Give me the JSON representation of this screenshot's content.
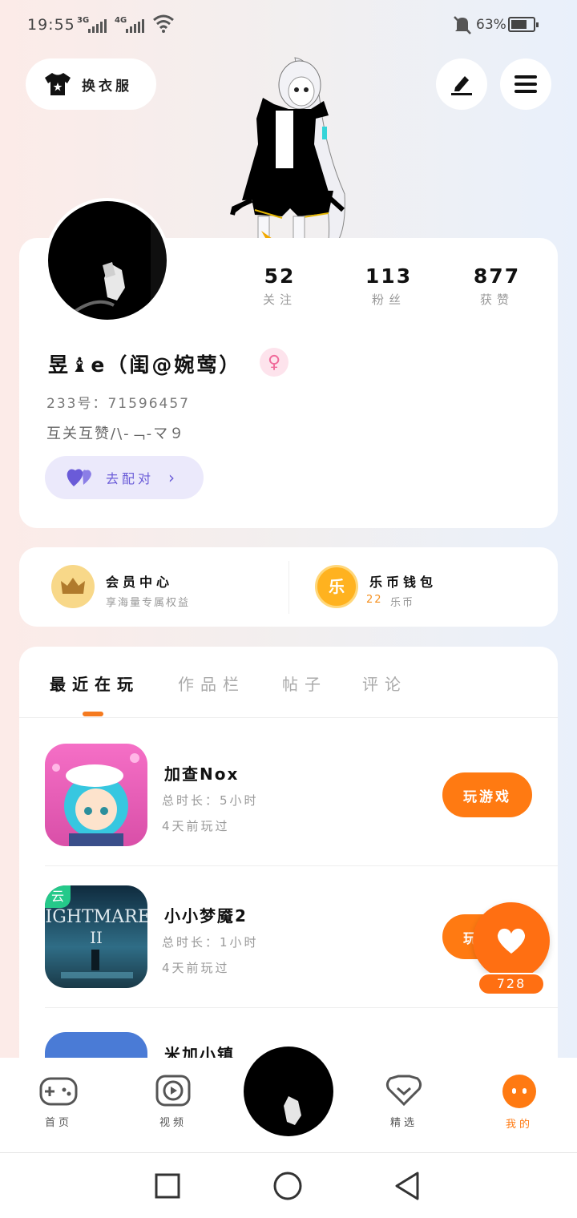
{
  "status_bar": {
    "time": "19:55",
    "net1": "3G",
    "net2": "4G",
    "battery": "63%"
  },
  "header": {
    "outfit_label": "换衣服"
  },
  "profile": {
    "stats": [
      {
        "value": "52",
        "label": "关注"
      },
      {
        "value": "113",
        "label": "粉丝"
      },
      {
        "value": "877",
        "label": "获赞"
      }
    ],
    "name": "昱♝e（闺@婉莺）",
    "uid": "233号：71596457",
    "bio": "互关互赞/\\-﹁-マ９",
    "match_label": "去配对"
  },
  "wallet": {
    "vip_title": "会员中心",
    "vip_sub": "享海量专属权益",
    "coin_title": "乐币钱包",
    "coin_amount": "22",
    "coin_unit": "乐币",
    "coin_glyph": "乐"
  },
  "tabs": [
    "最近在玩",
    "作品栏",
    "帖子",
    "评论"
  ],
  "games": [
    {
      "title": "加查Nox",
      "duration": "总时长：5小时",
      "last": "4天前玩过",
      "button": "玩游戏"
    },
    {
      "title": "小小梦魇2",
      "duration": "总时长：1小时",
      "last": "4天前玩过",
      "button": "玩游戏",
      "badge": "云"
    },
    {
      "title": "米加小镇"
    }
  ],
  "float_like": {
    "count": "728"
  },
  "bottom_nav": [
    {
      "label": "首页"
    },
    {
      "label": "视频"
    },
    {
      "label": "精选"
    },
    {
      "label": "我的"
    }
  ],
  "colors": {
    "accent": "#ff7a12",
    "match": "#6a5bd8",
    "active_nav": "#ff7a12"
  }
}
